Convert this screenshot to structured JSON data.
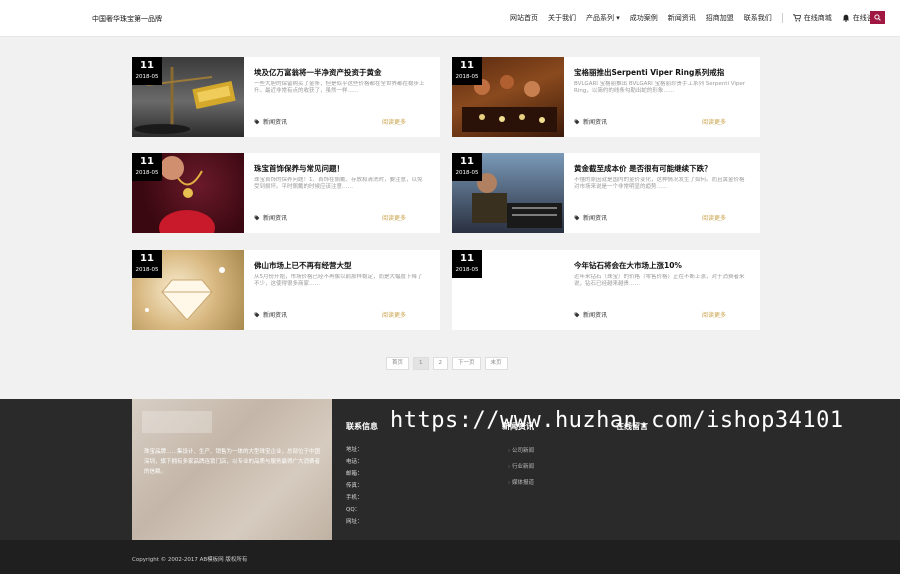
{
  "header": {
    "brand": "中国奢华珠宝第一品牌",
    "nav": [
      "网站首页",
      "关于我们",
      "产品系列",
      "成功案例",
      "新闻资讯",
      "招商加盟",
      "联系我们"
    ],
    "mall_label": "在线商城",
    "consult_label": "在线咨询"
  },
  "articles": [
    {
      "day": "11",
      "ym": "2018-05",
      "title": "埃及亿万富翁将一半净资产投资于黄金",
      "excerpt": "一些大胆的保留购买了金条，但是似乎这些价格都在全世界都在稳步上升。最近非常有点的收获了，虽然一样……",
      "category": "新闻资讯",
      "more": "阅读更多"
    },
    {
      "day": "11",
      "ym": "2018-05",
      "title": "宝格丽推出Serpenti Viper Ring系列戒指",
      "excerpt": "BVLGARI 宝格丽推出 BVLGARI 宝格丽珍贵手工系列 Serpenti Viper Ring，以简约的线条勾勒出蛇的形象……",
      "category": "新闻资讯",
      "more": "阅读更多"
    },
    {
      "day": "11",
      "ym": "2018-05",
      "title": "珠宝首饰保养与常见问题！",
      "excerpt": "珠宝首饰的保养问题！1、首饰在佩戴、存放和清洗时，要注意，以免受到损坏。平时佩戴的时候应该注意……",
      "category": "新闻资讯",
      "more": "阅读更多"
    },
    {
      "day": "11",
      "ym": "2018-05",
      "title": "黄金截至成本价 是否很有可能继续下跌？",
      "excerpt": "不懂的原因就是国内的金价变化，这种情况发生了如何。而且黄金价格对市场来说是一个非常明显的趋势……",
      "category": "新闻资讯",
      "more": "阅读更多"
    },
    {
      "day": "11",
      "ym": "2018-05",
      "title": "佛山市场上已不再有经营大型",
      "excerpt": "从5月份开始，市场价格已经不再像以前那样稳定，而是大幅度下降了不少，这使得很多商家……",
      "category": "新闻资讯",
      "more": "阅读更多"
    },
    {
      "day": "11",
      "ym": "2018-05",
      "title": "今年钻石将会在大市场上涨10%",
      "excerpt": "近年来钻石（珠宝）的价格（零售价格）正在不断上涨，对于消费者来说，钻石已经越来越贵……",
      "category": "新闻资讯",
      "more": "阅读更多"
    }
  ],
  "pager": [
    "首页",
    "1",
    "2",
    "下一页",
    "末页"
  ],
  "footer": {
    "description": "珠宝品牌……集设计、生产、销售为一体的大型珠宝企业，总部位于中国深圳，旗下拥有多家品牌连锁门店，以专业的品质与服务赢得广大消费者的信赖。",
    "contact_title": "联系信息",
    "contact_fields": [
      "地址：",
      "电话：",
      "邮箱：",
      "传真：",
      "手机：",
      "QQ：",
      "网址："
    ],
    "col2_title": "新闻资讯",
    "col2_items": [
      "公司新闻",
      "行业新闻",
      "媒体报道"
    ],
    "col3_title": "在线留言",
    "copyright": "Copyright © 2002-2017 AB模板网 版权所有"
  },
  "watermark": "https://www.huzhan.com/ishop34101"
}
